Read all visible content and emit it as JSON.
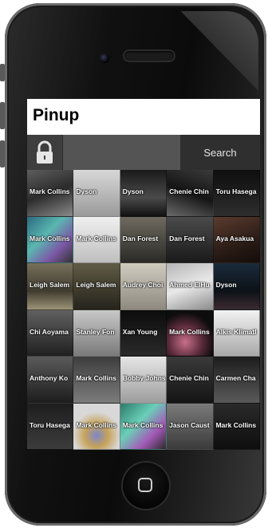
{
  "app": {
    "title": "Pinup",
    "search_label": "Search"
  },
  "tiles": [
    {
      "label": "Mark Collins",
      "bg": "linear-gradient(160deg,#5d5d5d,#2c2c2c 50%,#8a8a8a)"
    },
    {
      "label": "Dyson",
      "bg": "linear-gradient(180deg,#d8d8d8,#9a9a9a)"
    },
    {
      "label": "Dyson",
      "bg": "linear-gradient(180deg,#1a1a1a,#4a4a4a 60%,#111)"
    },
    {
      "label": "Chenie Chin",
      "bg": "linear-gradient(200deg,#3b3b3b,#151515 50%,#6b6b6b)"
    },
    {
      "label": "Toru Hasega",
      "bg": "linear-gradient(180deg,#0e0e0e,#2e2e2e)"
    },
    {
      "label": "Mark Collins",
      "bg": "linear-gradient(135deg,#2c6a7f,#5ab7b0 40%,#7c58a7 70%,#333)"
    },
    {
      "label": "Mark Collins",
      "bg": "linear-gradient(180deg,#f0f0f0,#bfbfbf)"
    },
    {
      "label": "Dan Forest",
      "bg": "linear-gradient(180deg,#6e6a60,#2b2a27)"
    },
    {
      "label": "Dan Forest",
      "bg": "linear-gradient(180deg,#4b4b4b,#1a1a1a)"
    },
    {
      "label": "Aya Asakua",
      "bg": "linear-gradient(160deg,#5b3b2e,#2a1c16 60%,#140c0a)"
    },
    {
      "label": "Leigh Salem",
      "bg": "linear-gradient(180deg,#77705b,#3f3b2f 60%,#9c9477)"
    },
    {
      "label": "Leigh Salem",
      "bg": "linear-gradient(180deg,#5f5b45,#26241c)"
    },
    {
      "label": "Audrey Choi",
      "bg": "linear-gradient(180deg,#d0cbbf,#8e8a80)"
    },
    {
      "label": "Ahmed ElHu",
      "bg": "linear-gradient(160deg,#b5b5b5,#e8e8e8 50%,#8c8c8c)"
    },
    {
      "label": "Dyson",
      "bg": "linear-gradient(180deg,#1b2b3a,#0c1218 60%,#3b2a30)"
    },
    {
      "label": "Chi Aoyama",
      "bg": "linear-gradient(180deg,#606060,#202020)"
    },
    {
      "label": "Stanley Fon",
      "bg": "linear-gradient(180deg,#c8c8c8,#7a7a7a)"
    },
    {
      "label": "Xan Young",
      "bg": "linear-gradient(180deg,#0c0c0c,#2a2a2a)"
    },
    {
      "label": "Mark Collins",
      "bg": "radial-gradient(circle at 40% 70%,#c8708a,#5a2a3a 40%,#0d0d0d 70%)"
    },
    {
      "label": "Alkis Klimatl",
      "bg": "linear-gradient(180deg,#f2f2f2,#a9a9a9)"
    },
    {
      "label": "Anthony Ko",
      "bg": "linear-gradient(180deg,#5a5a5a,#1d1d1d)"
    },
    {
      "label": "Mark Collins",
      "bg": "linear-gradient(180deg,#3d3d3d,#7c7c7c)"
    },
    {
      "label": "Bobby Johns",
      "bg": "linear-gradient(180deg,#e6e6e6,#9d9d9d)"
    },
    {
      "label": "Chenie Chin",
      "bg": "linear-gradient(180deg,#3a3a3a,#151515)"
    },
    {
      "label": "Carmen Cha",
      "bg": "linear-gradient(180deg,#1c1c1c,#5a5a5a)"
    },
    {
      "label": "Toru Hasega",
      "bg": "linear-gradient(180deg,#1e1e1e,#3c3c3c)"
    },
    {
      "label": "Mark Collins",
      "bg": "radial-gradient(circle at 50% 70%,#7c86c7,#c7a35a 30%,#d8d8d8 60%)"
    },
    {
      "label": "Mark Collins",
      "bg": "linear-gradient(135deg,#2c7a6a,#6acfb7 40%,#a35ab7 70%,#2a2a2a)"
    },
    {
      "label": "Jason Caust",
      "bg": "linear-gradient(180deg,#7a7a7a,#3b3b3b)"
    },
    {
      "label": "Mark Collins",
      "bg": "linear-gradient(180deg,#2a2a2a,#0e0e0e)"
    }
  ]
}
